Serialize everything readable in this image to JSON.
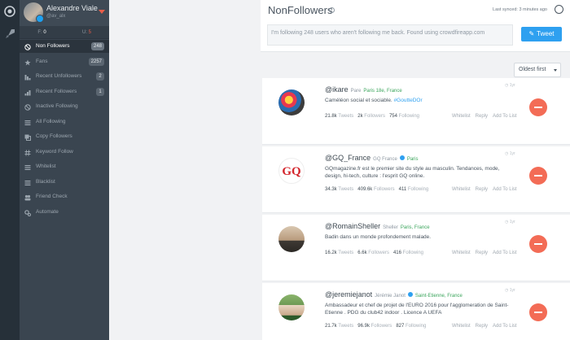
{
  "profile": {
    "name": "Alexandre Viale",
    "handle": "@av_alx"
  },
  "stats": {
    "following_label": "F:",
    "following_value": "0",
    "unfollowers_label": "U:",
    "unfollowers_value": "5"
  },
  "sidebar": {
    "items": [
      {
        "label": "Non Followers",
        "badge": "248",
        "icon": "ban-icon"
      },
      {
        "label": "Fans",
        "badge": "2257",
        "icon": "star-icon"
      },
      {
        "label": "Recent Unfollowers",
        "badge": "2",
        "icon": "chart-down-icon"
      },
      {
        "label": "Recent Followers",
        "badge": "1",
        "icon": "chart-up-icon"
      },
      {
        "label": "Inactive Following",
        "badge": "",
        "icon": "ban-icon"
      },
      {
        "label": "All Following",
        "badge": "",
        "icon": "list-icon"
      },
      {
        "label": "Copy Followers",
        "badge": "",
        "icon": "copy-icon"
      },
      {
        "label": "Keyword Follow",
        "badge": "",
        "icon": "hashtag-icon"
      },
      {
        "label": "Whitelist",
        "badge": "",
        "icon": "list-icon"
      },
      {
        "label": "Blacklist",
        "badge": "",
        "icon": "list-icon"
      },
      {
        "label": "Friend Check",
        "badge": "",
        "icon": "users-icon"
      },
      {
        "label": "Automate",
        "badge": "",
        "icon": "gears-icon"
      }
    ]
  },
  "header": {
    "title": "NonFollowers",
    "sync_text": "Last synced: 3 minutes ago"
  },
  "composer": {
    "text": "I'm following 248 users who aren't following me back. Found using crowdfireapp.com",
    "tweet_label": "Tweet"
  },
  "sort": {
    "selected": "Oldest first"
  },
  "actions": {
    "whitelist": "Whitelist",
    "reply": "Reply",
    "add_to_list": "Add To List"
  },
  "stat_labels": {
    "tweets": "Tweets",
    "followers": "Followers",
    "following": "Following"
  },
  "users": [
    {
      "handle": "@ikare",
      "display_name": "Pare",
      "location": "Paris 18e, France",
      "verified": false,
      "bio": "Caméléon social et sociable.",
      "bio_tag": "#GoutteDOr",
      "tweets": "21.8k",
      "followers": "2k",
      "following": "754",
      "time": "1yr"
    },
    {
      "handle": "@GQ_France",
      "display_name": "GQ France",
      "location": "Paris",
      "verified": true,
      "bio": "GQmagazine.fr est le premier site du style au masculin. Tendances, mode, design, hi-tech, culture : l'esprit GQ online.",
      "bio_tag": "",
      "tweets": "34.3k",
      "followers": "409.6k",
      "following": "411",
      "time": "1yr"
    },
    {
      "handle": "@RomainSheller",
      "display_name": "Sheller",
      "location": "Paris, France",
      "verified": false,
      "bio": "Badin dans un monde profondement malade.",
      "bio_tag": "",
      "tweets": "16.2k",
      "followers": "6.6k",
      "following": "416",
      "time": "1yr"
    },
    {
      "handle": "@jeremiejanot",
      "display_name": "Jérémie Janot",
      "location": "Saint-Etienne, France",
      "verified": true,
      "bio": "Ambassadeur et chef de projet de l'EURO 2016 pour l'agglomeration de Saint-Etienne . PDG du club42 indoor . Licence A UEFA",
      "bio_tag": "",
      "tweets": "21.7k",
      "followers": "96.9k",
      "following": "827",
      "time": "1yr"
    }
  ],
  "colors": {
    "accent": "#2ea0f0",
    "unfollow": "#f36c56",
    "sidebar": "#3a4550",
    "rail": "#263039"
  }
}
